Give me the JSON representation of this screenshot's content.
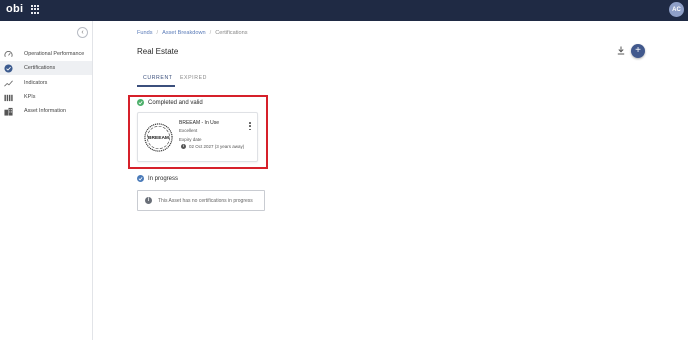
{
  "app": {
    "logo": "obi",
    "avatar_initials": "AC"
  },
  "sidebar": {
    "collapse_glyph": "‹",
    "items": [
      {
        "label": "Operational Performance",
        "icon": "speedometer-icon",
        "active": false
      },
      {
        "label": "Certifications",
        "icon": "verified-check-icon",
        "active": true
      },
      {
        "label": "Indicators",
        "icon": "trend-line-icon",
        "active": false
      },
      {
        "label": "KPIs",
        "icon": "bars-icon",
        "active": false
      },
      {
        "label": "Asset Information",
        "icon": "building-icon",
        "active": false
      }
    ]
  },
  "breadcrumb": {
    "items": [
      "Funds",
      "Asset Breakdown",
      "Certifications"
    ],
    "separator": "/"
  },
  "page": {
    "title": "Real Estate",
    "add_glyph": "+"
  },
  "tabs": {
    "current": "CURRENT",
    "expired": "EXPIRED"
  },
  "completed": {
    "heading": "Completed and valid",
    "card": {
      "logo_text": "BREEAM",
      "name": "BREEAM - In Use",
      "rating": "Excellent",
      "expiry_label": "Expiry date",
      "expiry_value": "02 Oct 2027 (3 years away)"
    }
  },
  "in_progress": {
    "heading": "In progress",
    "empty_message": "This Asset has no certifications in progress",
    "info_glyph": "i"
  },
  "colors": {
    "topbar": "#1f2a44",
    "accent": "#41588c",
    "highlight": "#d6202a",
    "success": "#4caf6a"
  }
}
